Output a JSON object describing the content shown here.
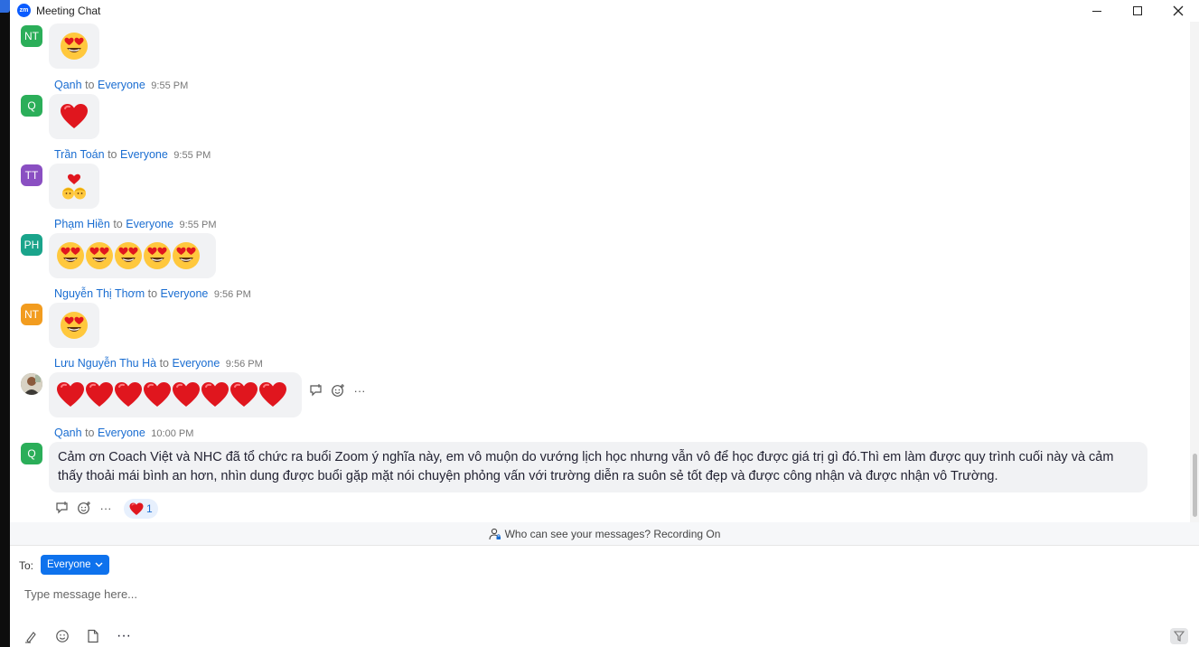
{
  "window": {
    "title": "Meeting Chat",
    "logo_text": "zm"
  },
  "messages": [
    {
      "initials": "NT",
      "avatar_color": "#2bae59",
      "emoji": "heart-eyes",
      "count": 1
    },
    {
      "sender": "Qanh",
      "to_word": "to",
      "target": "Everyone",
      "time": "9:55 PM",
      "initials": "Q",
      "avatar_color": "#2bae59",
      "emoji": "red-heart",
      "count": 1
    },
    {
      "sender": "Trần Toán",
      "to_word": "to",
      "target": "Everyone",
      "time": "9:55 PM",
      "initials": "TT",
      "avatar_color": "#8a4fc2",
      "emoji": "couple-with-heart",
      "count": 1
    },
    {
      "sender": "Phạm Hiền",
      "to_word": "to",
      "target": "Everyone",
      "time": "9:55 PM",
      "initials": "PH",
      "avatar_color": "#1aa48b",
      "emoji": "heart-eyes",
      "count": 5
    },
    {
      "sender": "Nguyễn Thị Thơm",
      "to_word": "to",
      "target": "Everyone",
      "time": "9:56 PM",
      "initials": "NT",
      "avatar_color": "#f29c1f",
      "emoji": "heart-eyes",
      "count": 1
    },
    {
      "sender": "Lưu Nguyễn Thu Hà",
      "to_word": "to",
      "target": "Everyone",
      "time": "9:56 PM",
      "avatar": "photo",
      "emoji": "red-heart",
      "count": 8
    },
    {
      "sender": "Qanh",
      "to_word": "to",
      "target": "Everyone",
      "time": "10:00 PM",
      "initials": "Q",
      "avatar_color": "#2bae59",
      "text": "Cảm ơn Coach Việt và NHC đã tổ chức ra buổi Zoom ý nghĩa này, em vô muộn do vướng lịch học nhưng vẫn vô để học được giá trị gì đó.Thì em làm được quy trình cuối này và cảm thấy thoải mái bình an hơn, nhìn dung được buổi gặp mặt nói chuyện phỏng vấn với trường diễn ra suôn sẻ tốt đẹp và được công nhận và được nhận vô Trường.",
      "reaction": {
        "emoji": "red-heart",
        "count": "1"
      }
    }
  ],
  "hover_tools": [
    "reply-icon",
    "add-reaction-icon",
    "more-icon"
  ],
  "hover_more_label": "···",
  "notice": {
    "text": "Who can see your messages? Recording On",
    "icon": "person-lock-icon"
  },
  "composer": {
    "to_label": "To:",
    "recipient": "Everyone",
    "placeholder": "Type message here...",
    "tools": [
      "format-icon",
      "emoji-icon",
      "file-icon",
      "more-icon"
    ],
    "more_label": "···"
  },
  "colors": {
    "accent": "#0e72ed",
    "link": "#1a6dd1",
    "bubble": "#f1f2f4"
  }
}
